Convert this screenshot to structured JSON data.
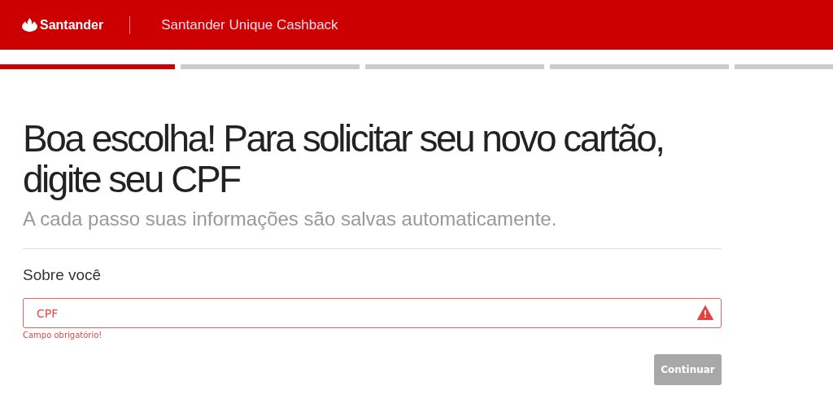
{
  "header": {
    "brand": "Santander",
    "product": "Santander Unique Cashback"
  },
  "steps": [
    {
      "selected": true
    },
    {
      "selected": false
    },
    {
      "selected": false
    },
    {
      "selected": false
    },
    {
      "selected": false
    }
  ],
  "title": "Boa escolha! Para solicitar seu novo cartão, digite seu CPF",
  "subtitle": "A cada passo suas informações são salvas automaticamente.",
  "section": "Sobre você",
  "field": {
    "placeholder": "CPF",
    "error": true,
    "error_text": "Campo obrigatório!"
  },
  "button": {
    "label": "Continuar",
    "disabled": true
  }
}
